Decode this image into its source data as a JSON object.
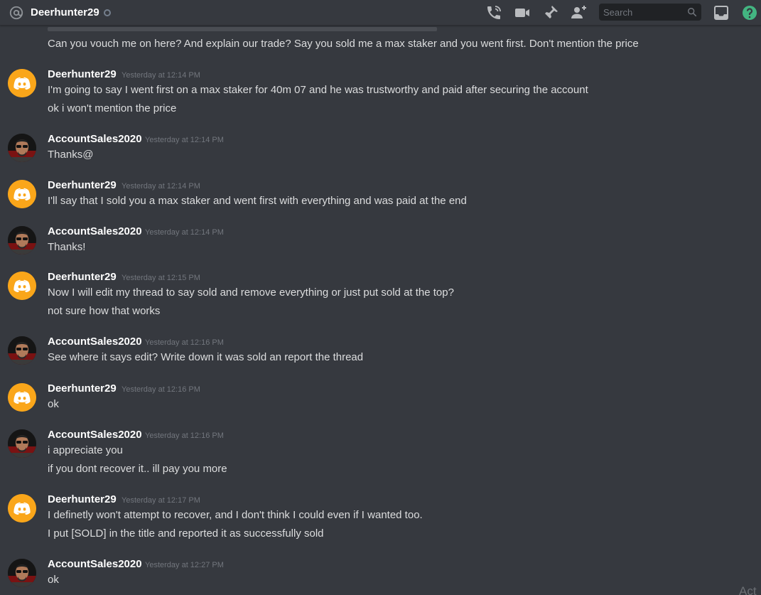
{
  "header": {
    "channel_name": "Deerhunter29",
    "search_placeholder": "Search",
    "icons": [
      "at-icon",
      "status-offline-icon",
      "call-icon",
      "video-icon",
      "pin-icon",
      "add-member-icon",
      "search-icon",
      "inbox-icon",
      "help-icon"
    ],
    "colors": {
      "help": "#43b581",
      "status": "#747f8d"
    }
  },
  "colors": {
    "background": "#36393f",
    "discord_avatar": "#faa61a",
    "username": "#ffffff",
    "timestamp": "#72767d",
    "text": "#dcddde"
  },
  "prev_message": "Can you vouch me on here? And explain our trade? Say you sold me a max staker and you went first. Don't mention the price",
  "messages": [
    {
      "author": "Deerhunter29",
      "timestamp": "Yesterday at 12:14 PM",
      "avatar": "discord-logo-icon",
      "lines": [
        "I'm going to say I went first on a max staker for 40m 07 and he was trustworthy and paid after securing the account",
        "ok i won't mention the price"
      ]
    },
    {
      "author": "AccountSales2020",
      "timestamp": "Yesterday at 12:14 PM",
      "avatar": "user-photo",
      "lines": [
        "Thanks@"
      ]
    },
    {
      "author": "Deerhunter29",
      "timestamp": "Yesterday at 12:14 PM",
      "avatar": "discord-logo-icon",
      "lines": [
        "I'll say that I sold you a max staker and went first with everything and was paid at the end"
      ]
    },
    {
      "author": "AccountSales2020",
      "timestamp": "Yesterday at 12:14 PM",
      "avatar": "user-photo",
      "lines": [
        "Thanks!"
      ]
    },
    {
      "author": "Deerhunter29",
      "timestamp": "Yesterday at 12:15 PM",
      "avatar": "discord-logo-icon",
      "lines": [
        "Now I will edit my thread to say sold and remove everything or just put sold at the top?",
        "not sure how that works"
      ]
    },
    {
      "author": "AccountSales2020",
      "timestamp": "Yesterday at 12:16 PM",
      "avatar": "user-photo",
      "lines": [
        "See where it says edit? Write down it was sold an report the thread"
      ]
    },
    {
      "author": "Deerhunter29",
      "timestamp": "Yesterday at 12:16 PM",
      "avatar": "discord-logo-icon",
      "lines": [
        "ok"
      ]
    },
    {
      "author": "AccountSales2020",
      "timestamp": "Yesterday at 12:16 PM",
      "avatar": "user-photo",
      "lines": [
        "i appreciate you",
        "if you dont recover it.. ill pay you more"
      ]
    },
    {
      "author": "Deerhunter29",
      "timestamp": "Yesterday at 12:17 PM",
      "avatar": "discord-logo-icon",
      "lines": [
        "I definetly won't attempt to recover, and I don't think I could even if I wanted too.",
        "I put [SOLD] in the title and reported it as successfully sold"
      ]
    },
    {
      "author": "AccountSales2020",
      "timestamp": "Yesterday at 12:27 PM",
      "avatar": "user-photo",
      "lines": [
        "ok"
      ]
    }
  ],
  "watermark": "Act"
}
